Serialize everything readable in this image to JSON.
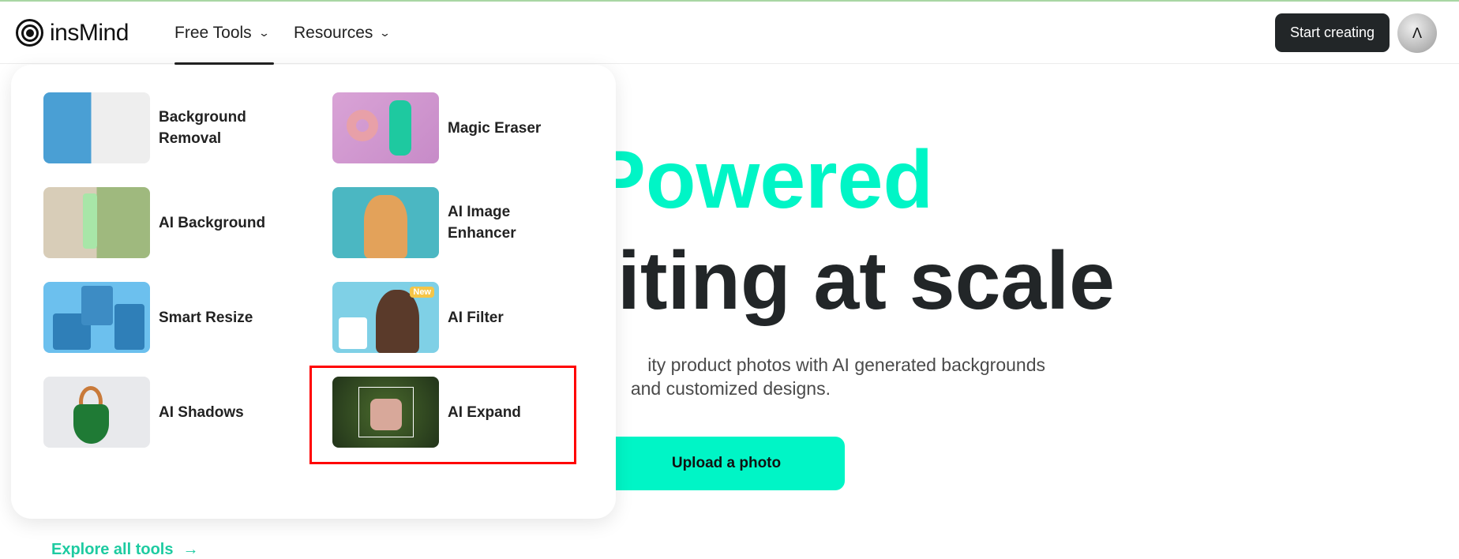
{
  "header": {
    "logo_text": "insMind",
    "nav": [
      {
        "label": "Free Tools",
        "active": true
      },
      {
        "label": "Resources",
        "active": false
      }
    ],
    "start_button": "Start creating",
    "avatar_icon": "assassin-emblem"
  },
  "hero": {
    "title_line1_fragment": "-Powered",
    "title_line2_fragment": "diting at scale",
    "subtitle_line1_fragment": "ity product photos with AI generated backgrounds",
    "subtitle_line2_fragment": "and customized designs.",
    "upload_button": "Upload a photo",
    "accent_color": "#00f5c6"
  },
  "dropdown": {
    "tools": [
      {
        "label": "Background Removal"
      },
      {
        "label": "Magic Eraser"
      },
      {
        "label": "AI Background"
      },
      {
        "label": "AI Image Enhancer"
      },
      {
        "label": "Smart Resize"
      },
      {
        "label": "AI Filter",
        "badge": "New"
      },
      {
        "label": "AI Shadows"
      },
      {
        "label": "AI Expand",
        "highlighted": true
      }
    ],
    "explore_link": "Explore all tools",
    "explore_color": "#1ecba1",
    "highlight_color": "#ff0000"
  }
}
